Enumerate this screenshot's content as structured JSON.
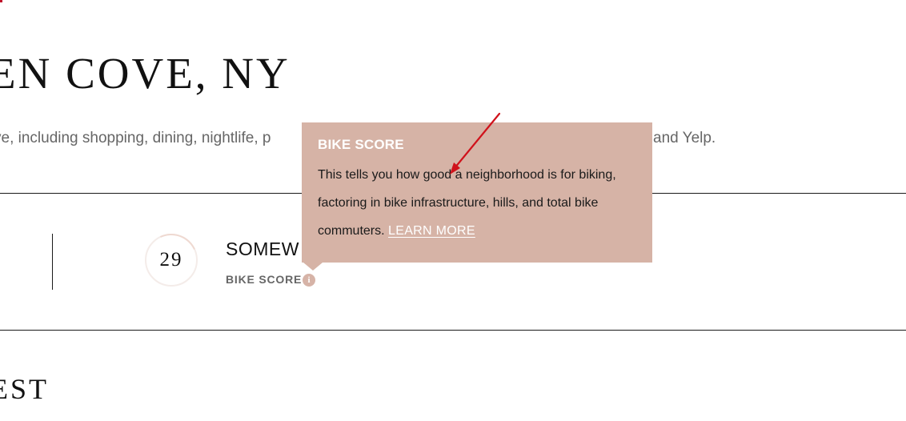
{
  "page": {
    "title": "EN COVE, NY",
    "description_left": "ve, including shopping, dining, nightlife, p",
    "description_right": "and Yelp.",
    "section_heading": "EST"
  },
  "score_card": {
    "score": "29",
    "rating": "SOMEW",
    "label": "BIKE SCORE",
    "info_icon": "i"
  },
  "tooltip": {
    "title": "BIKE SCORE",
    "body": "This tells you how good a neighborhood is for biking, factoring in bike infrastructure, hills, and total bike commuters.",
    "link_label": "LEARN MORE"
  },
  "colors": {
    "tooltip_bg": "#d6b3a6",
    "accent_red": "#d0121b",
    "text_dark": "#111111",
    "text_muted": "#666666"
  },
  "icons": {
    "info": "info-icon",
    "annotation": "red-arrow-annotation"
  }
}
